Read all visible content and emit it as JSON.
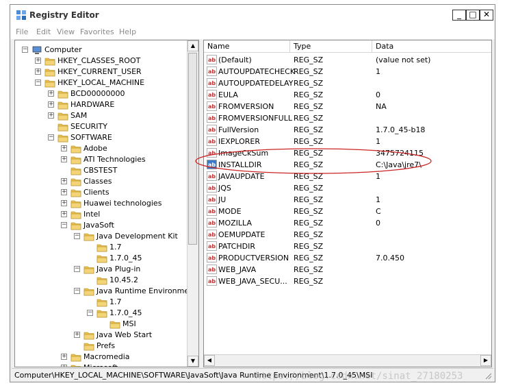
{
  "window": {
    "title": "Registry Editor"
  },
  "controls": {
    "minimize": "_",
    "maximize": "□",
    "close": "✕"
  },
  "menu": [
    "File",
    "Edit",
    "View",
    "Favorites",
    "Help"
  ],
  "tree": [
    {
      "label": "Computer",
      "level": 0,
      "expander": "−",
      "icon": "computer-icon"
    },
    {
      "label": "HKEY_CLASSES_ROOT",
      "level": 1,
      "expander": "+",
      "icon": "folder-icon"
    },
    {
      "label": "HKEY_CURRENT_USER",
      "level": 1,
      "expander": "+",
      "icon": "folder-icon"
    },
    {
      "label": "HKEY_LOCAL_MACHINE",
      "level": 1,
      "expander": "−",
      "icon": "folder-icon"
    },
    {
      "label": "BCD00000000",
      "level": 2,
      "expander": "+",
      "icon": "folder-icon"
    },
    {
      "label": "HARDWARE",
      "level": 2,
      "expander": "+",
      "icon": "folder-icon"
    },
    {
      "label": "SAM",
      "level": 2,
      "expander": "+",
      "icon": "folder-icon"
    },
    {
      "label": "SECURITY",
      "level": 2,
      "expander": "",
      "icon": "folder-icon"
    },
    {
      "label": "SOFTWARE",
      "level": 2,
      "expander": "−",
      "icon": "folder-icon"
    },
    {
      "label": "Adobe",
      "level": 3,
      "expander": "+",
      "icon": "folder-icon"
    },
    {
      "label": "ATI Technologies",
      "level": 3,
      "expander": "+",
      "icon": "folder-icon"
    },
    {
      "label": "CBSTEST",
      "level": 3,
      "expander": "",
      "icon": "folder-icon"
    },
    {
      "label": "Classes",
      "level": 3,
      "expander": "+",
      "icon": "folder-icon"
    },
    {
      "label": "Clients",
      "level": 3,
      "expander": "+",
      "icon": "folder-icon"
    },
    {
      "label": "Huawei technologies",
      "level": 3,
      "expander": "+",
      "icon": "folder-icon"
    },
    {
      "label": "Intel",
      "level": 3,
      "expander": "+",
      "icon": "folder-icon"
    },
    {
      "label": "JavaSoft",
      "level": 3,
      "expander": "−",
      "icon": "folder-icon"
    },
    {
      "label": "Java Development Kit",
      "level": 4,
      "expander": "−",
      "icon": "folder-icon"
    },
    {
      "label": "1.7",
      "level": 5,
      "expander": "",
      "icon": "folder-icon"
    },
    {
      "label": "1.7.0_45",
      "level": 5,
      "expander": "",
      "icon": "folder-icon"
    },
    {
      "label": "Java Plug-in",
      "level": 4,
      "expander": "−",
      "icon": "folder-icon"
    },
    {
      "label": "10.45.2",
      "level": 5,
      "expander": "",
      "icon": "folder-icon"
    },
    {
      "label": "Java Runtime Environment",
      "level": 4,
      "expander": "−",
      "icon": "folder-icon"
    },
    {
      "label": "1.7",
      "level": 5,
      "expander": "",
      "icon": "folder-icon"
    },
    {
      "label": "1.7.0_45",
      "level": 5,
      "expander": "−",
      "icon": "folder-icon"
    },
    {
      "label": "MSI",
      "level": 6,
      "expander": "",
      "icon": "folder-icon"
    },
    {
      "label": "Java Web Start",
      "level": 4,
      "expander": "+",
      "icon": "folder-icon"
    },
    {
      "label": "Prefs",
      "level": 4,
      "expander": "",
      "icon": "folder-icon"
    },
    {
      "label": "Macromedia",
      "level": 3,
      "expander": "+",
      "icon": "folder-icon"
    },
    {
      "label": "Microsoft",
      "level": 3,
      "expander": "+",
      "icon": "folder-icon"
    }
  ],
  "list": {
    "columns": [
      "Name",
      "Type",
      "Data"
    ],
    "rows": [
      {
        "name": "(Default)",
        "type": "REG_SZ",
        "data": "(value not set)"
      },
      {
        "name": "AUTOUPDATECHECK",
        "type": "REG_SZ",
        "data": "1"
      },
      {
        "name": "AUTOUPDATEDELAY",
        "type": "REG_SZ",
        "data": ""
      },
      {
        "name": "EULA",
        "type": "REG_SZ",
        "data": "0"
      },
      {
        "name": "FROMVERSION",
        "type": "REG_SZ",
        "data": "NA"
      },
      {
        "name": "FROMVERSIONFULL",
        "type": "REG_SZ",
        "data": ""
      },
      {
        "name": "FullVersion",
        "type": "REG_SZ",
        "data": "1.7.0_45-b18"
      },
      {
        "name": "IEXPLORER",
        "type": "REG_SZ",
        "data": "1"
      },
      {
        "name": "ImageCkSum",
        "type": "REG_SZ",
        "data": "3475724115"
      },
      {
        "name": "INSTALLDIR",
        "type": "REG_SZ",
        "data": "C:\\Java\\jre7\\"
      },
      {
        "name": "JAVAUPDATE",
        "type": "REG_SZ",
        "data": "1"
      },
      {
        "name": "JQS",
        "type": "REG_SZ",
        "data": ""
      },
      {
        "name": "JU",
        "type": "REG_SZ",
        "data": "1"
      },
      {
        "name": "MODE",
        "type": "REG_SZ",
        "data": "C"
      },
      {
        "name": "MOZILLA",
        "type": "REG_SZ",
        "data": "0"
      },
      {
        "name": "OEMUPDATE",
        "type": "REG_SZ",
        "data": ""
      },
      {
        "name": "PATCHDIR",
        "type": "REG_SZ",
        "data": ""
      },
      {
        "name": "PRODUCTVERSION",
        "type": "REG_SZ",
        "data": "7.0.450"
      },
      {
        "name": "WEB_JAVA",
        "type": "REG_SZ",
        "data": ""
      },
      {
        "name": "WEB_JAVA_SECU...",
        "type": "REG_SZ",
        "data": ""
      }
    ],
    "value_icon": "ab-string-icon"
  },
  "status": {
    "path": "Computer\\HKEY_LOCAL_MACHINE\\SOFTWARE\\JavaSoft\\Java Runtime Environment\\1.7.0_45\\MSI",
    "watermark": "https://blog.csdn.net/sinat_27180253"
  },
  "colors": {
    "highlight_ellipse": "#cc2222",
    "folder": "#e8c050",
    "selected_icon": "#3c78c8"
  }
}
